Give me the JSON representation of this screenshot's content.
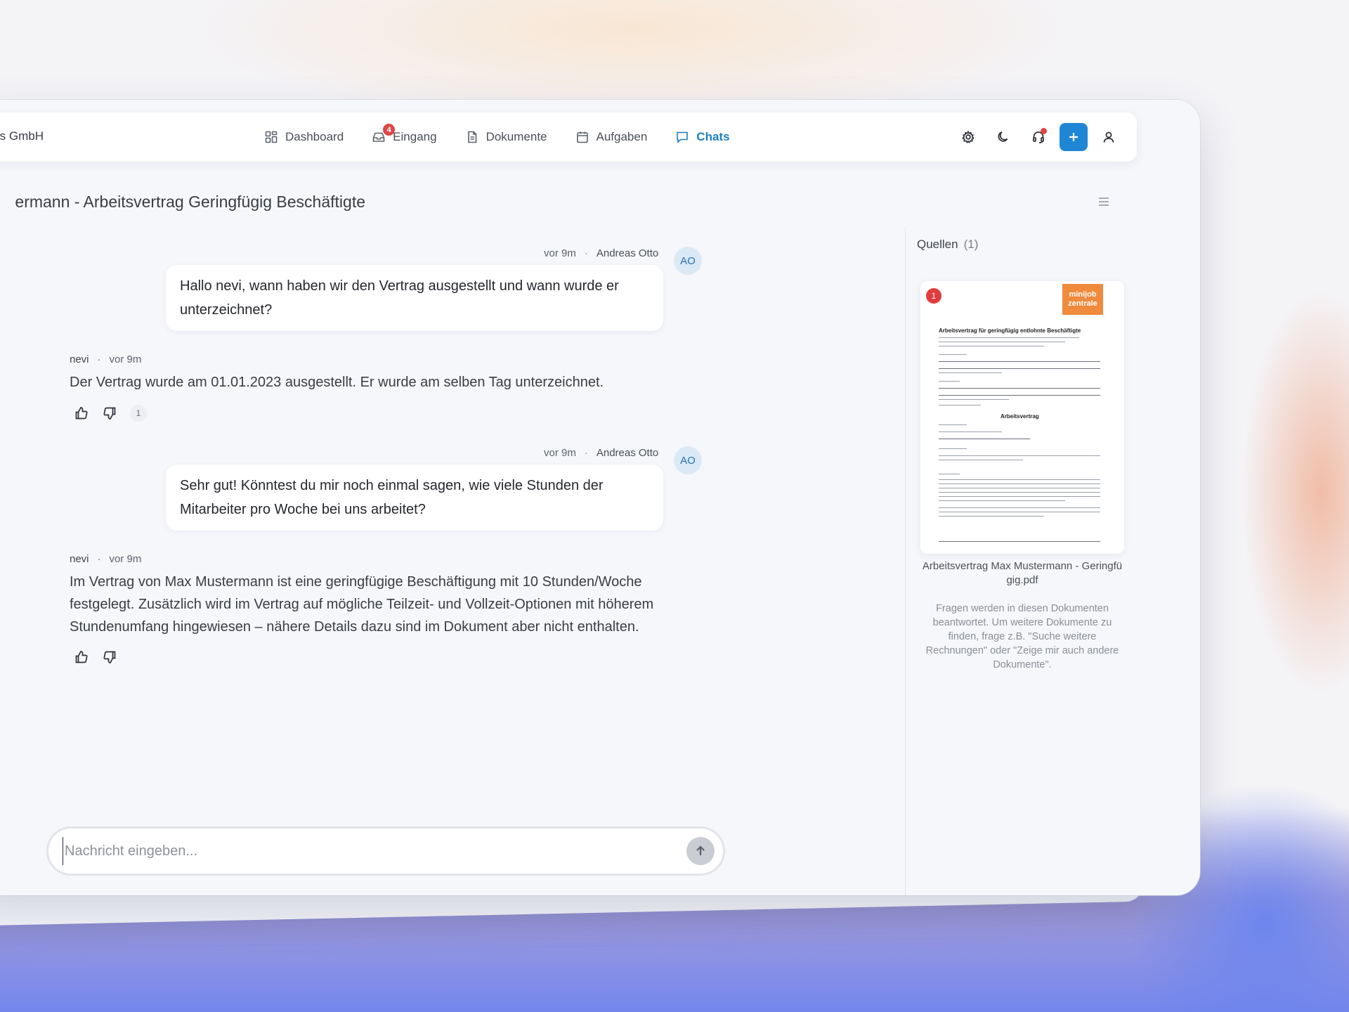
{
  "header": {
    "company": "s GmbH",
    "nav": [
      {
        "label": "Dashboard",
        "icon": "dashboard-icon",
        "active": false
      },
      {
        "label": "Eingang",
        "icon": "inbox-icon",
        "badge": "4",
        "active": false
      },
      {
        "label": "Dokumente",
        "icon": "document-icon",
        "active": false
      },
      {
        "label": "Aufgaben",
        "icon": "calendar-icon",
        "active": false
      },
      {
        "label": "Chats",
        "icon": "chat-icon",
        "active": true
      }
    ],
    "tools": [
      "gear-icon",
      "moon-icon",
      "headset-icon",
      "plus-icon",
      "user-icon"
    ]
  },
  "chat": {
    "title": "ermann - Arbeitsvertrag Geringfügig Beschäftigte",
    "messages": [
      {
        "role": "user",
        "time": "vor 9m",
        "author": "Andreas Otto",
        "initials": "AO",
        "text": "Hallo nevi, wann haben wir den Vertrag ausgestellt und wann wurde er unterzeichnet?"
      },
      {
        "role": "bot",
        "name": "nevi",
        "time": "vor 9m",
        "text": "Der Vertrag wurde am 01.01.2023 ausgestellt. Er wurde am selben Tag unterzeichnet.",
        "source_count": "1"
      },
      {
        "role": "user",
        "time": "vor 9m",
        "author": "Andreas Otto",
        "initials": "AO",
        "text": "Sehr gut! Könntest du mir noch einmal sagen, wie viele Stunden der Mitarbeiter pro Woche bei uns arbeitet?"
      },
      {
        "role": "bot",
        "name": "nevi",
        "time": "vor 9m",
        "text": "Im Vertrag von Max Mustermann ist eine geringfügige Beschäftigung mit 10 Stunden/Woche festgelegt. Zusätzlich wird im Vertrag auf mögliche Teilzeit- und Vollzeit-Optionen mit höherem Stundenumfang hingewiesen – nähere Details dazu sind im Dokument aber nicht enthalten."
      }
    ],
    "composer": {
      "placeholder": "Nachricht eingeben..."
    }
  },
  "sources": {
    "label": "Quellen",
    "count": "(1)",
    "documents": [
      {
        "number": "1",
        "logo_line1": "minijob",
        "logo_line2": "zentrale",
        "heading": "Arbeitsvertrag für geringfügig entlohnte Beschäftigte",
        "subheading": "Arbeitsvertrag",
        "filename": "Arbeitsvertrag Max Mustermann - Geringfügig.pdf"
      }
    ],
    "hint": "Fragen werden in diesen Dokumenten beantwortet. Um weitere Dokumente zu finden, frage z.B. \"Suche weitere Rechnungen\" oder \"Zeige mir auch andere Dokumente\"."
  },
  "colors": {
    "accent": "#1f86d6",
    "active_nav": "#1e7fc0",
    "badge": "#e04545",
    "logo": "#f08a3c"
  }
}
